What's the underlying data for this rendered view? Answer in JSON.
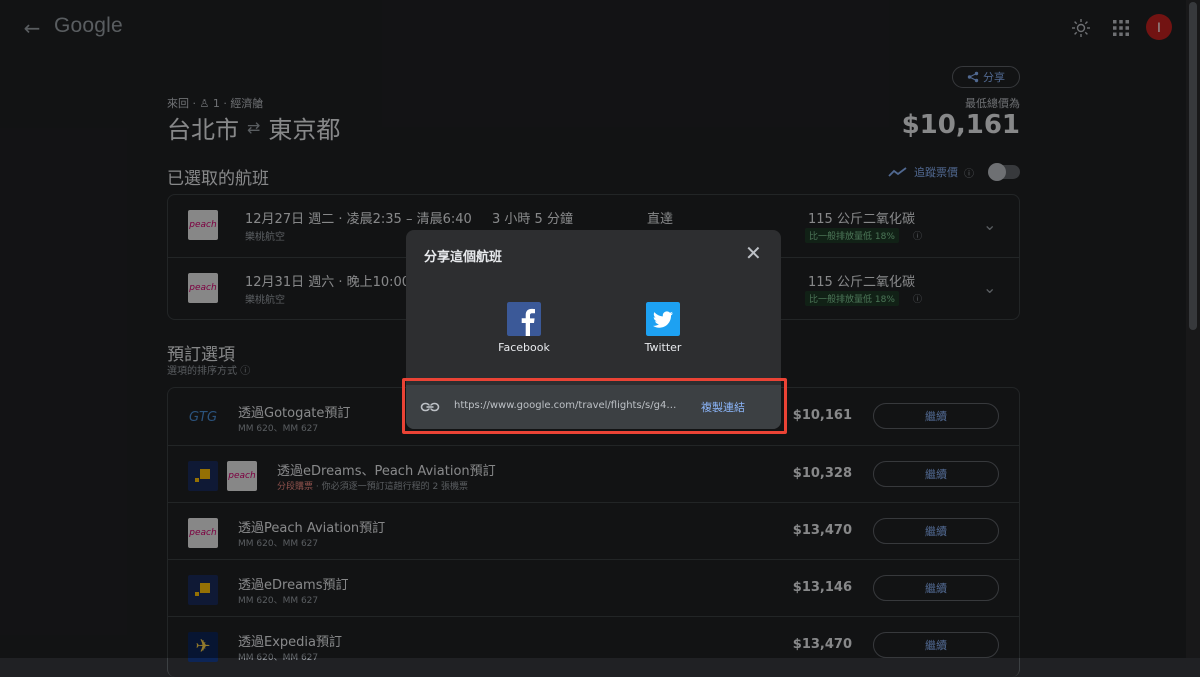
{
  "header": {
    "logo": "Google",
    "avatar_initial": "I"
  },
  "trip": {
    "share_label": "分享",
    "meta": "來回 · ♙ 1 · 經濟艙",
    "origin": "台北市",
    "destination": "東京都",
    "lowest_label": "最低總價為",
    "lowest_price": "$10,161"
  },
  "selected": {
    "title": "已選取的航班",
    "track_label": "追蹤票價",
    "flights": [
      {
        "logo": "peach",
        "time": "12月27日 週二 · 凌晨2:35 – 清晨6:40",
        "airline": "樂桃航空",
        "duration": "3 小時 5 分鐘",
        "stops": "直達",
        "co2": "115 公斤二氧化碳",
        "badge": "比一般排放量低 18%"
      },
      {
        "logo": "peach",
        "time": "12月31日 週六 · 晚上10:00",
        "airline": "樂桃航空",
        "duration": "",
        "stops": "",
        "co2": "115 公斤二氧化碳",
        "badge": "比一般排放量低 18%"
      }
    ]
  },
  "booking": {
    "title": "預訂選項",
    "sort_label": "選項的排序方式",
    "button_label": "繼續",
    "options": [
      {
        "logo_text": "GTG",
        "name": "透過Gotogate預訂",
        "sub": "MM 620、MM 627",
        "price": "$10,161"
      },
      {
        "name": "透過eDreams、Peach Aviation預訂",
        "sub_red": "分段購票",
        "sub": " · 你必須逐一預訂這趟行程的 2 張機票",
        "price": "$10,328",
        "logo2_text": "peach"
      },
      {
        "logo_text": "peach",
        "name": "透過Peach Aviation預訂",
        "sub": "MM 620、MM 627",
        "price": "$13,470"
      },
      {
        "name": "透過eDreams預訂",
        "sub": "MM 620、MM 627",
        "price": "$13,146"
      },
      {
        "logo_text": "✈",
        "name": "透過Expedia預訂",
        "sub": "MM 620、MM 627",
        "price": "$13,470"
      }
    ]
  },
  "dialog": {
    "title": "分享這個航班",
    "facebook": "Facebook",
    "twitter": "Twitter",
    "url": "https://www.google.com/travel/flights/s/g4…",
    "copy_label": "複製連結"
  },
  "colors": {
    "accent": "#8ab4f8",
    "highlight": "#ea4335",
    "background": "#202124"
  }
}
